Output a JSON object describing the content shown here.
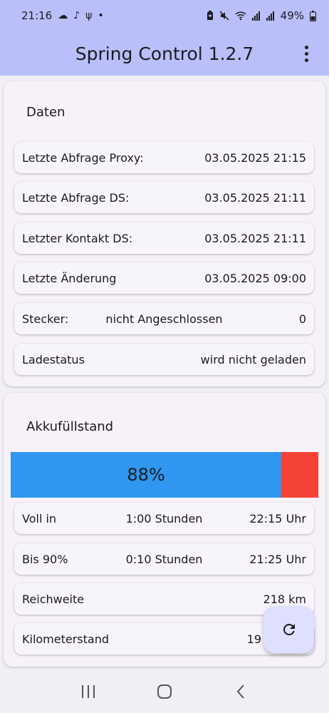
{
  "status_bar": {
    "time": "21:16",
    "battery": "49%",
    "left_icons": [
      "cloud-icon",
      "music-note-icon",
      "usb-icon",
      "dot-icon"
    ],
    "right_icons": [
      "battery-saver-icon",
      "mute-icon",
      "wifi-icon",
      "signal-icon",
      "signal-icon",
      "battery-icon"
    ]
  },
  "app_bar": {
    "title": "Spring Control 1.2.7"
  },
  "daten_card": {
    "title": "Daten",
    "rows": [
      {
        "label": "Letzte Abfrage Proxy:",
        "value": "03.05.2025 21:15"
      },
      {
        "label": "Letzte Abfrage DS:",
        "value": "03.05.2025 21:11"
      },
      {
        "label": "Letzter Kontakt DS:",
        "value": "03.05.2025 21:11"
      },
      {
        "label": "Letzte Änderung",
        "value": "03.05.2025 09:00"
      },
      {
        "label": "Stecker:",
        "middle": "nicht Angeschlossen",
        "value": "0"
      },
      {
        "label": "Ladestatus",
        "value": "wird nicht geladen"
      }
    ]
  },
  "akku_card": {
    "title": "Akkufüllstand",
    "percent_label": "88%",
    "level": 0.88,
    "colors": {
      "filled": "#2f97f0",
      "remaining": "#f44336"
    },
    "rows": [
      {
        "label": "Voll in",
        "middle": "1:00 Stunden",
        "value": "22:15 Uhr"
      },
      {
        "label": "Bis 90%",
        "middle": "0:10 Stunden",
        "value": "21:25 Uhr"
      },
      {
        "label": "Reichweite",
        "value": "218 km"
      },
      {
        "label": "Kilometerstand",
        "value": "19"
      }
    ]
  },
  "fab": {
    "icon": "refresh-icon"
  },
  "nav_bar": {
    "icons": [
      "recent-apps-icon",
      "home-icon",
      "back-icon"
    ]
  }
}
